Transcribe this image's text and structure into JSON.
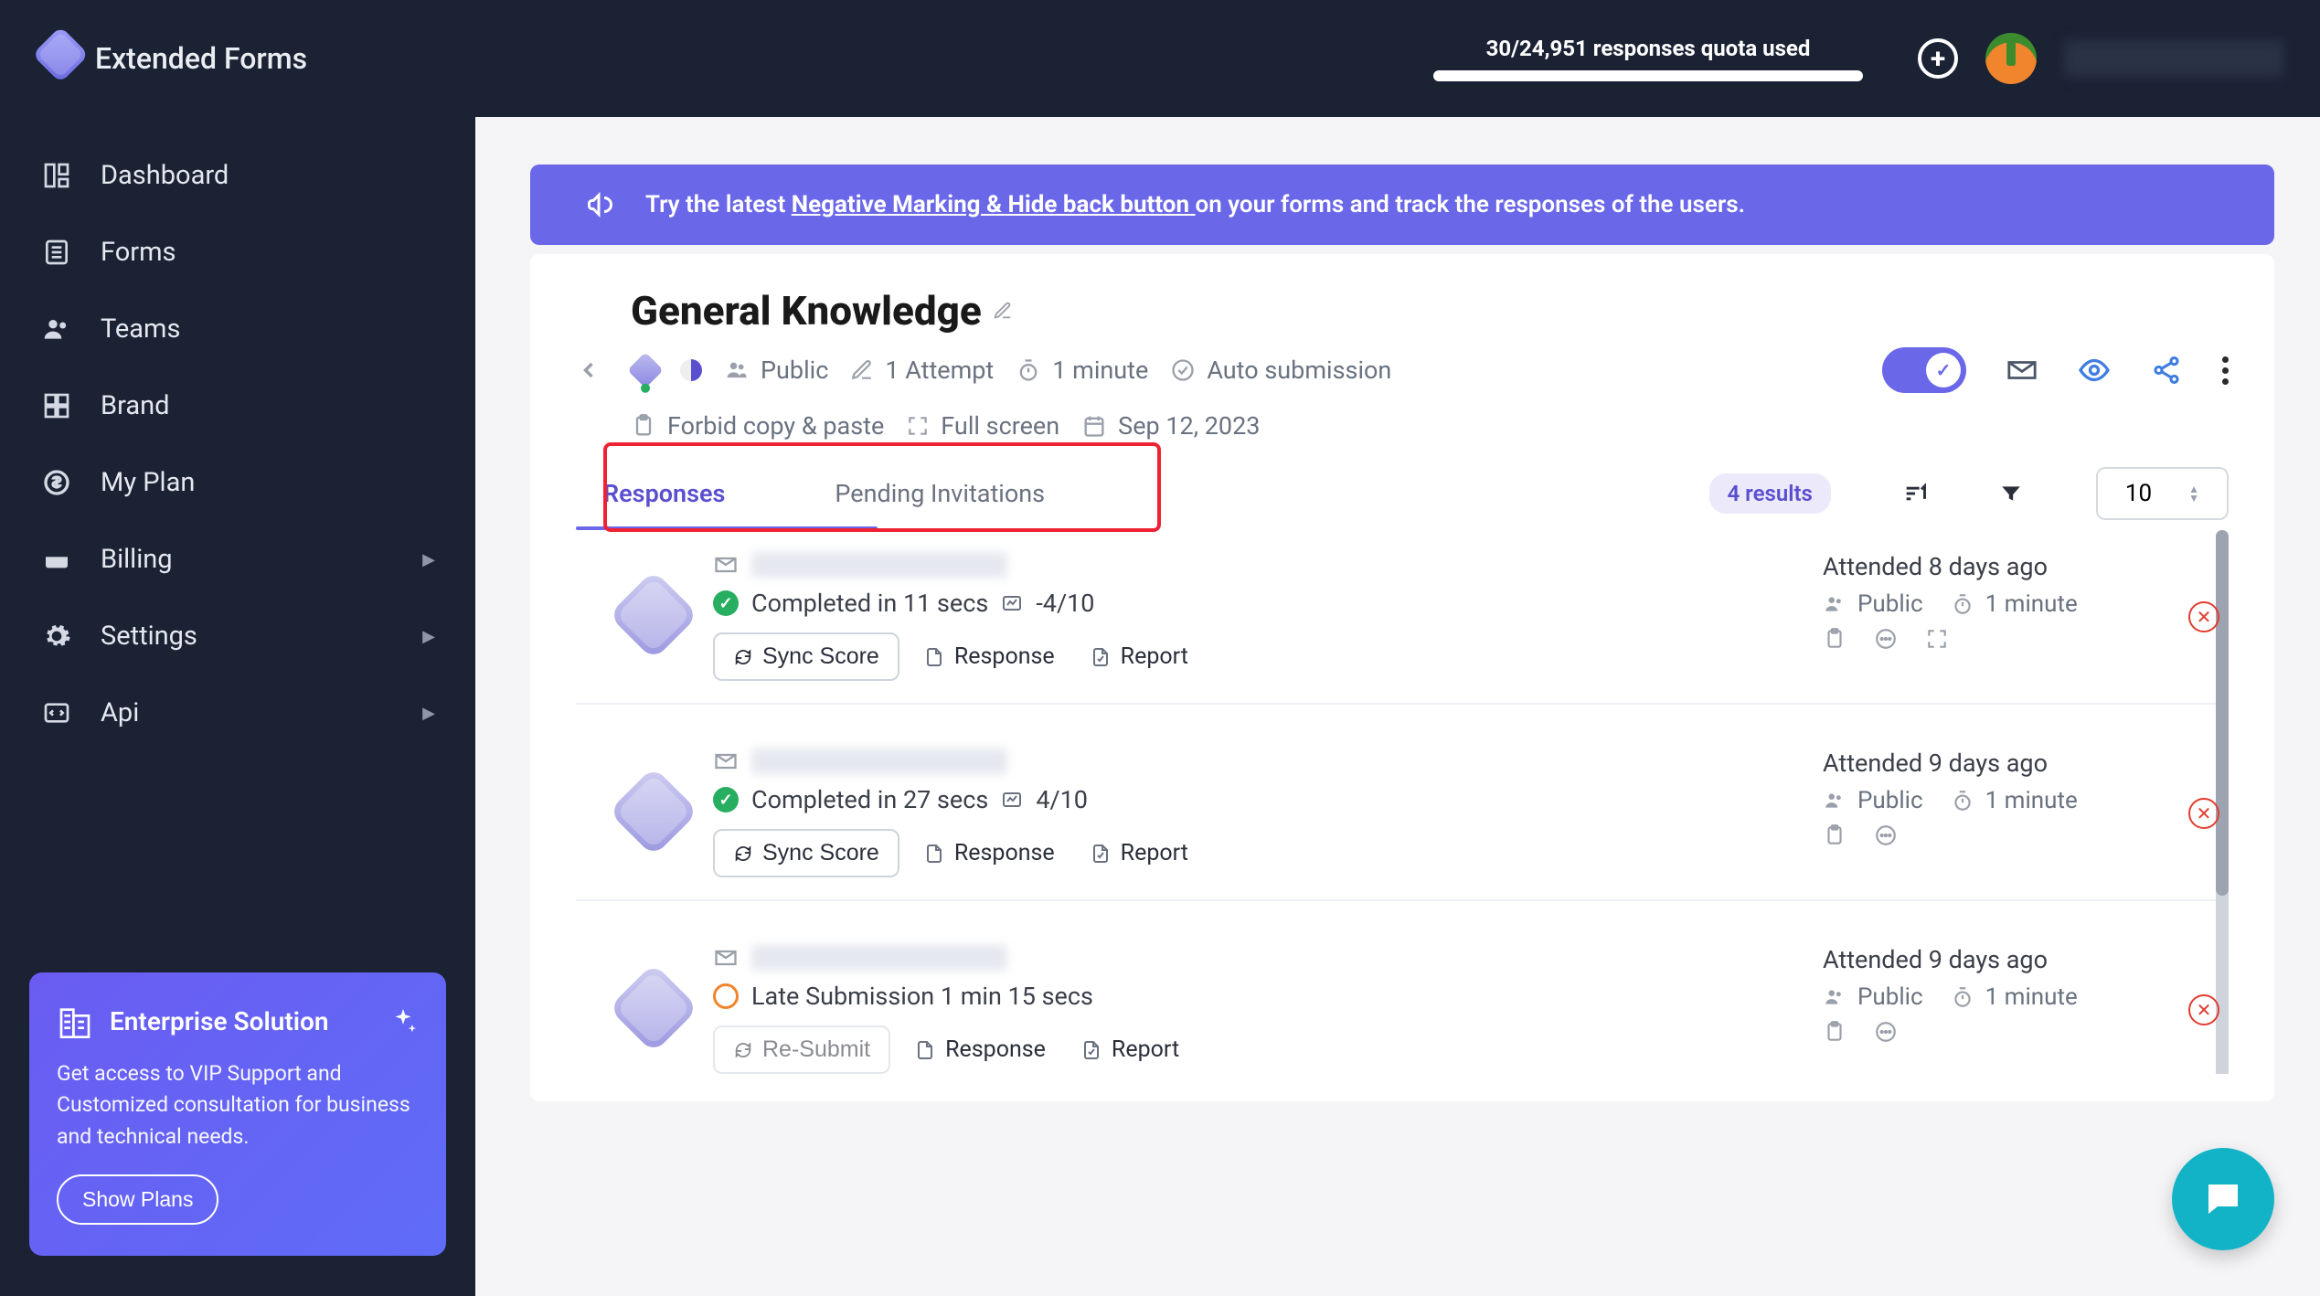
{
  "brand": "Extended Forms",
  "quota_text": "30/24,951 responses quota used",
  "sidebar": {
    "items": [
      {
        "label": "Dashboard",
        "icon": "grid"
      },
      {
        "label": "Forms",
        "icon": "list"
      },
      {
        "label": "Teams",
        "icon": "people"
      },
      {
        "label": "Brand",
        "icon": "grid4"
      },
      {
        "label": "My Plan",
        "icon": "coin"
      },
      {
        "label": "Billing",
        "icon": "wallet",
        "sub": true
      },
      {
        "label": "Settings",
        "icon": "gear",
        "sub": true
      },
      {
        "label": "Api",
        "icon": "code",
        "sub": true
      }
    ]
  },
  "promo": {
    "title": "Enterprise Solution",
    "desc": "Get access to VIP Support and Customized consultation for business and technical needs.",
    "cta": "Show Plans"
  },
  "banner": {
    "prefix": "Try the latest ",
    "link": "Negative Marking & Hide back button ",
    "suffix": "on your forms and track the responses of the users."
  },
  "form": {
    "title": "General Knowledge",
    "meta": {
      "visibility": "Public",
      "attempts": "1 Attempt",
      "timer": "1 minute",
      "auto": "Auto submission",
      "forbid": "Forbid copy & paste",
      "fullscreen": "Full screen",
      "date": "Sep 12, 2023"
    }
  },
  "tabs": {
    "responses": "Responses",
    "pending": "Pending Invitations"
  },
  "results_label": "4 results",
  "page_size": "10",
  "labels": {
    "sync": "Sync Score",
    "resubmit": "Re-Submit",
    "response": "Response",
    "report": "Report",
    "public": "Public",
    "one_min": "1 minute"
  },
  "rows": [
    {
      "status": "Completed in 11 secs",
      "score": "-4/10",
      "attended": "Attended 8 days ago",
      "ok": true,
      "expand": true
    },
    {
      "status": "Completed in 27 secs",
      "score": "4/10",
      "attended": "Attended 9 days ago",
      "ok": true,
      "expand": false
    },
    {
      "status": "Late Submission 1 min 15 secs",
      "score": "",
      "attended": "Attended 9 days ago",
      "ok": false,
      "expand": false
    }
  ]
}
